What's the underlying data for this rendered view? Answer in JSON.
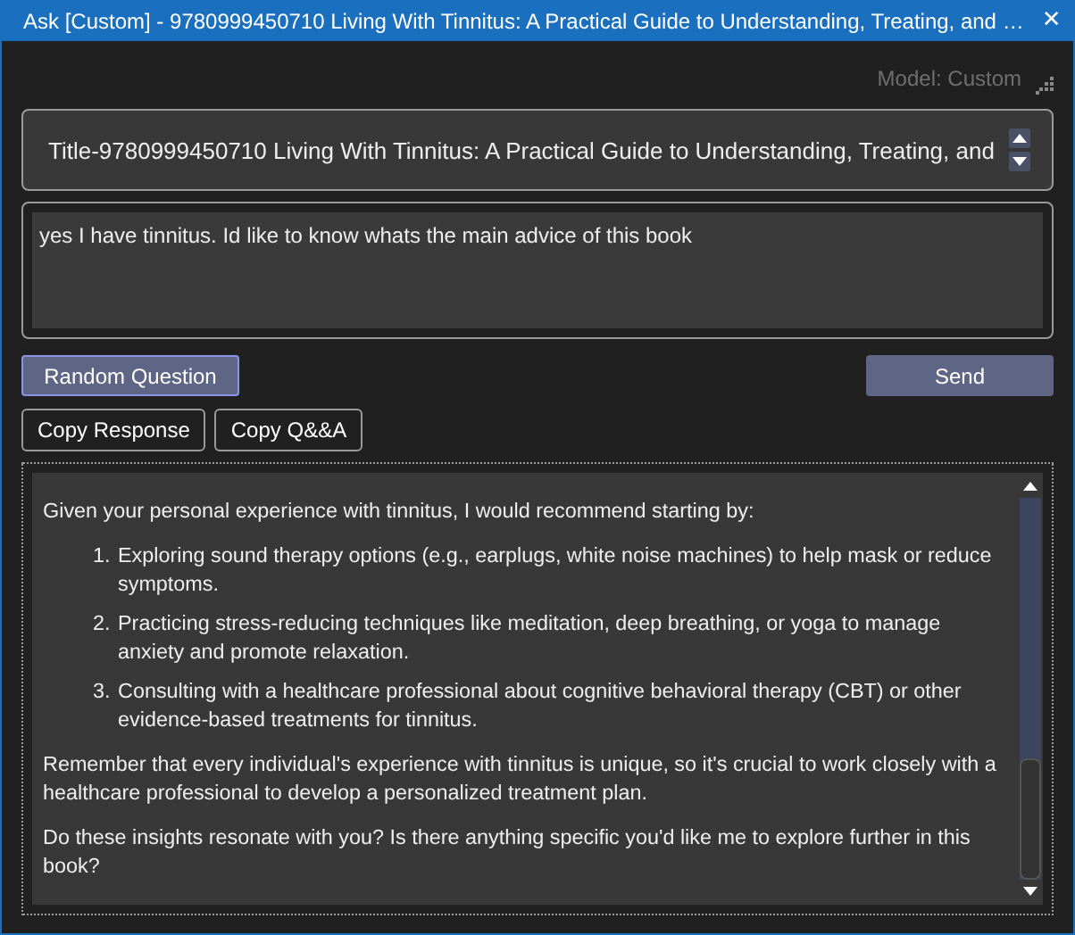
{
  "window": {
    "title": "Ask [Custom] - 9780999450710 Living With Tinnitus: A Practical Guide to Understanding, Treating, and …",
    "close": "✕"
  },
  "model_label": "Model: Custom",
  "book_title": {
    "value": "Title-9780999450710 Living With Tinnitus: A Practical Guide to Understanding, Treating, and"
  },
  "question": {
    "value": "yes I have tinnitus. Id like to know whats the main advice of this book"
  },
  "action_buttons": [
    {
      "label": "Random Question",
      "focused": true
    },
    {
      "label": "Send",
      "focused": false
    }
  ],
  "copy_buttons": [
    "Copy Response",
    "Copy Q&&A"
  ],
  "response": [
    {
      "kind": "paragraph",
      "text": "Given your personal experience with tinnitus, I would recommend starting by:"
    },
    {
      "kind": "list",
      "items": [
        {
          "number": "1.",
          "text": "Exploring sound therapy options (e.g., earplugs, white noise machines) to help mask or reduce symptoms."
        },
        {
          "number": "2.",
          "text": "Practicing stress-reducing techniques like meditation, deep breathing, or yoga to manage anxiety and promote relaxation."
        },
        {
          "number": "3.",
          "text": "Consulting with a healthcare professional about cognitive behavioral therapy (CBT) or other evidence-based treatments for tinnitus."
        }
      ]
    },
    {
      "kind": "paragraph",
      "text": "Remember that every individual's experience with tinnitus is unique, so it's crucial to work closely with a healthcare professional to develop a personalized treatment plan."
    },
    {
      "kind": "paragraph",
      "text": "Do these insights resonate with you? Is there anything specific you'd like me to explore further in this book?"
    }
  ]
}
